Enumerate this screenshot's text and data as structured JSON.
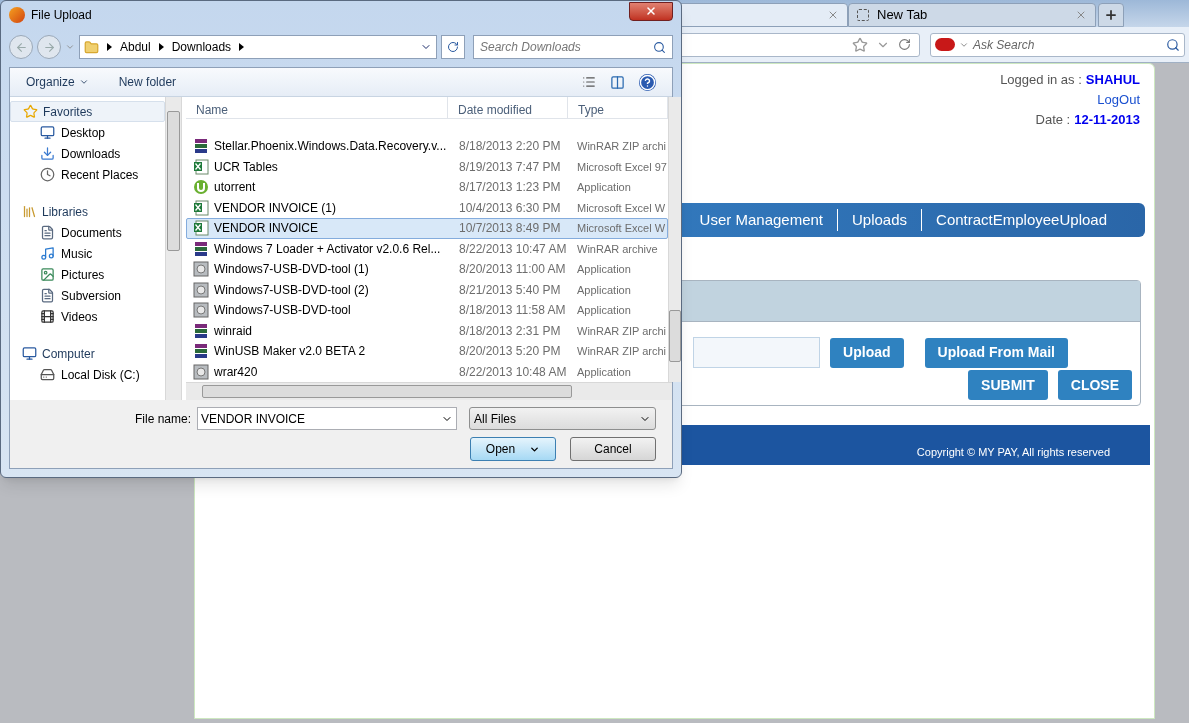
{
  "browser": {
    "tabs": [
      {
        "selected": true
      },
      {
        "title": "New Tab",
        "selected": false
      }
    ],
    "search": {
      "placeholder": "Ask Search"
    }
  },
  "page": {
    "logged_in_label": "Logged in as :",
    "user": "SHAHUL",
    "logout": "LogOut",
    "date_label": "Date :",
    "date": "12-11-2013",
    "menu": [
      "User Management",
      "Uploads",
      "ContractEmployeeUpload"
    ],
    "upload_buttons": [
      "Upload",
      "Upload From Mail"
    ],
    "action_buttons": [
      "SUBMIT",
      "CLOSE"
    ],
    "footer": "Copyright © MY PAY, All rights reserved"
  },
  "dialog": {
    "title": "File Upload",
    "path": [
      "Abdul",
      "Downloads"
    ],
    "search": {
      "placeholder": "Search Downloads"
    },
    "toolbar": {
      "organize": "Organize",
      "new_folder": "New folder"
    },
    "nav": [
      {
        "label": "Favorites",
        "kind": "star",
        "selected": true,
        "children": [
          {
            "label": "Desktop",
            "kind": "desktop"
          },
          {
            "label": "Downloads",
            "kind": "downloads"
          },
          {
            "label": "Recent Places",
            "kind": "recent"
          }
        ]
      },
      {
        "label": "Libraries",
        "kind": "libraries",
        "selected": false,
        "children": [
          {
            "label": "Documents",
            "kind": "documents"
          },
          {
            "label": "Music",
            "kind": "music"
          },
          {
            "label": "Pictures",
            "kind": "pictures"
          },
          {
            "label": "Subversion",
            "kind": "documents"
          },
          {
            "label": "Videos",
            "kind": "videos"
          }
        ]
      },
      {
        "label": "Computer",
        "kind": "computer",
        "selected": false,
        "children": [
          {
            "label": "Local Disk (C:)",
            "kind": "disk"
          }
        ]
      }
    ],
    "columns": [
      "Name",
      "Date modified",
      "Type"
    ],
    "rows": [
      {
        "name": "Stellar.Phoenix.Windows.Data.Recovery.v...",
        "date": "8/18/2013 2:20 PM",
        "type": "WinRAR ZIP archi",
        "kind": "archive",
        "selected": false
      },
      {
        "name": "UCR Tables",
        "date": "8/19/2013 7:47 PM",
        "type": "Microsoft Excel 97",
        "kind": "spreadsheet",
        "selected": false
      },
      {
        "name": "utorrent",
        "date": "8/17/2013 1:23 PM",
        "type": "Application",
        "kind": "torrent",
        "selected": false
      },
      {
        "name": "VENDOR INVOICE (1)",
        "date": "10/4/2013 6:30 PM",
        "type": "Microsoft Excel W",
        "kind": "spreadsheet",
        "selected": false
      },
      {
        "name": "VENDOR INVOICE",
        "date": "10/7/2013 8:49 PM",
        "type": "Microsoft Excel W",
        "kind": "spreadsheet",
        "selected": true
      },
      {
        "name": "Windows 7 Loader + Activator v2.0.6 Rel...",
        "date": "8/22/2013 10:47 AM",
        "type": "WinRAR archive",
        "kind": "archive",
        "selected": false
      },
      {
        "name": "Windows7-USB-DVD-tool (1)",
        "date": "8/20/2013 11:00 AM",
        "type": "Application",
        "kind": "installer",
        "selected": false
      },
      {
        "name": "Windows7-USB-DVD-tool (2)",
        "date": "8/21/2013 5:40 PM",
        "type": "Application",
        "kind": "installer",
        "selected": false
      },
      {
        "name": "Windows7-USB-DVD-tool",
        "date": "8/18/2013 11:58 AM",
        "type": "Application",
        "kind": "installer",
        "selected": false
      },
      {
        "name": "winraid",
        "date": "8/18/2013 2:31 PM",
        "type": "WinRAR ZIP archi",
        "kind": "archive",
        "selected": false
      },
      {
        "name": "WinUSB Maker v2.0 BETA 2",
        "date": "8/20/2013 5:20 PM",
        "type": "WinRAR ZIP archi",
        "kind": "archive",
        "selected": false
      },
      {
        "name": "wrar420",
        "date": "8/22/2013 10:48 AM",
        "type": "Application",
        "kind": "installer",
        "selected": false
      }
    ],
    "file_name_label": "File name:",
    "file_name": "VENDOR INVOICE",
    "filter": "All Files",
    "buttons": [
      "Open",
      "Cancel"
    ]
  }
}
